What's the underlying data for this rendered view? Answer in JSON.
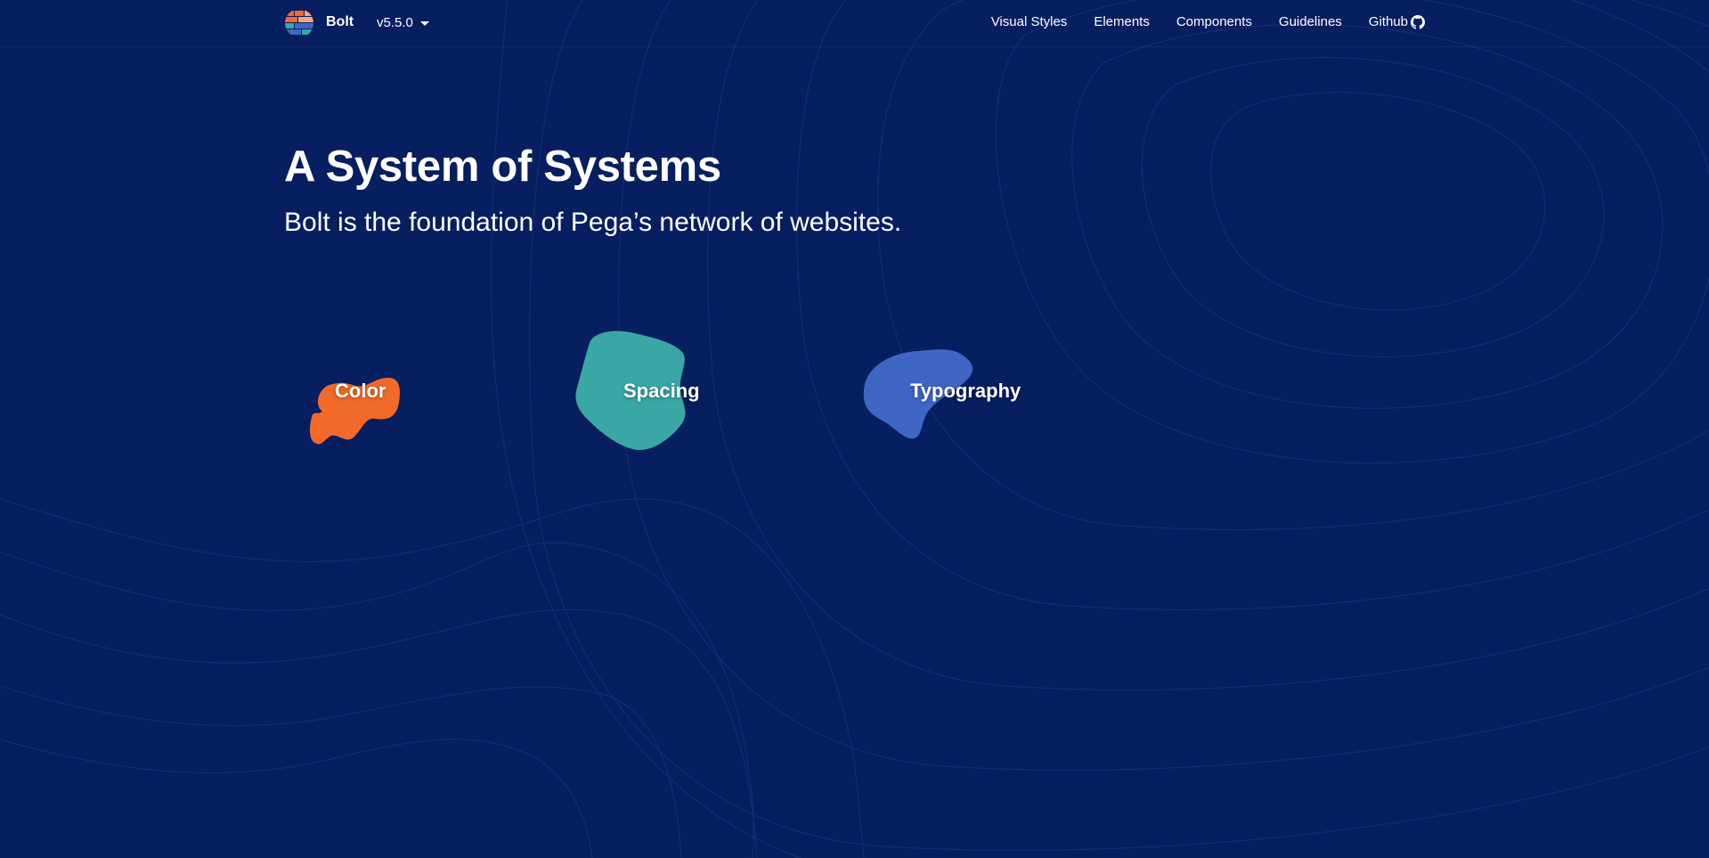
{
  "nav": {
    "brand": "Bolt",
    "version": "v5.5.0",
    "links": [
      {
        "label": "Visual Styles"
      },
      {
        "label": "Elements"
      },
      {
        "label": "Components"
      },
      {
        "label": "Guidelines"
      },
      {
        "label": "Github",
        "icon": "github-icon"
      }
    ]
  },
  "hero": {
    "title": "A System of Systems",
    "subtitle": "Bolt is the foundation of Pega’s network of websites."
  },
  "cards": [
    {
      "label": "Color",
      "color": "#f26a29"
    },
    {
      "label": "Spacing",
      "color": "#3aa7a4"
    },
    {
      "label": "Typography",
      "color": "#3f66c4"
    }
  ],
  "colors": {
    "background": "#071e60",
    "text": "#ffffff",
    "topo_lines": "#2a3f86"
  }
}
